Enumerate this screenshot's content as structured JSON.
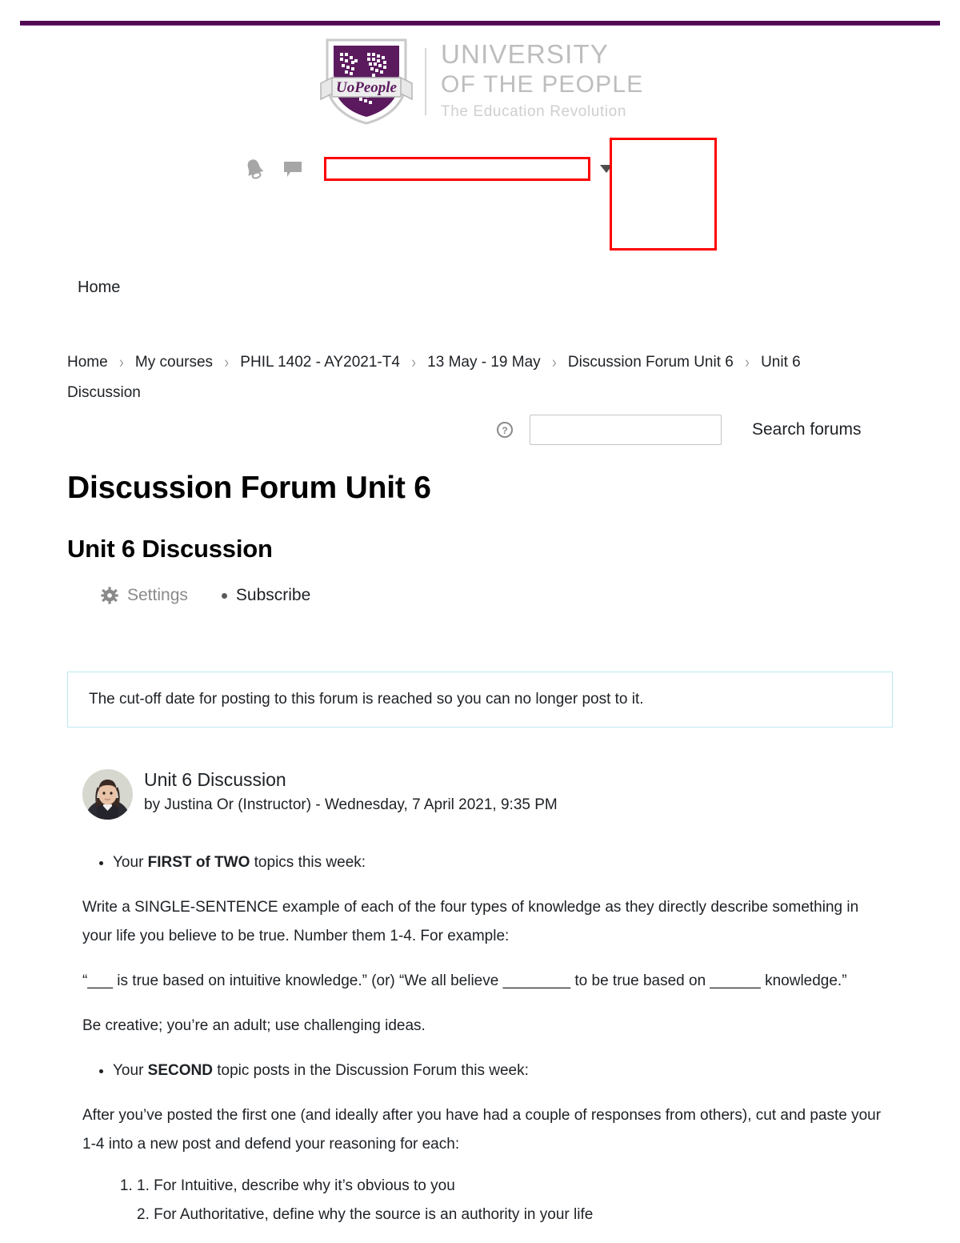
{
  "theme": {
    "brand_purple": "#520a53",
    "highlight_red": "#ff0000",
    "alert_border_blue": "#bce8f1",
    "muted_gray": "#8a8a8a"
  },
  "logo": {
    "badge_text": "UoPeople",
    "line1": "UNIVERSITY",
    "line2": "OF THE PEOPLE",
    "line3": "The Education Revolution"
  },
  "utility_bar": {
    "bell_icon": "bell-icon",
    "messages_icon": "speech-bubble-icon",
    "search_value": "",
    "search_placeholder": "",
    "caret_icon": "chevron-down-icon"
  },
  "primary_nav": {
    "home_label": "Home"
  },
  "breadcrumb": {
    "separator": "›",
    "items": [
      {
        "label": "Home"
      },
      {
        "label": "My courses"
      },
      {
        "label": "PHIL 1402 - AY2021-T4"
      },
      {
        "label": "13 May - 19 May"
      },
      {
        "label": "Discussion Forum Unit 6"
      },
      {
        "label": "Unit 6 Discussion"
      }
    ]
  },
  "forum_search": {
    "help_icon": "help-circle-icon",
    "input_value": "",
    "input_placeholder": "",
    "button_label": "Search forums"
  },
  "headings": {
    "forum_title": "Discussion Forum Unit 6",
    "discussion_title": "Unit 6 Discussion"
  },
  "actions": {
    "settings_icon": "gear-icon",
    "settings_label": "Settings",
    "subscribe_bullet_icon": "dot-icon",
    "subscribe_label": "Subscribe"
  },
  "alert": {
    "message": "The cut-off date for posting to this forum is reached so you can no longer post to it."
  },
  "post": {
    "avatar_icon": "user-avatar-photo",
    "subject": "Unit 6 Discussion",
    "byline": "by Justina Or (Instructor) - Wednesday, 7 April 2021, 9:35 PM",
    "bullet_first": {
      "before": "Your ",
      "bold": "FIRST of TWO",
      "after": " topics this week:"
    },
    "paragraph_1": "Write a SINGLE-SENTENCE example of each of the four types of knowledge as they directly describe something in your life you believe to be true. Number them 1-4.  For example:",
    "paragraph_2": "“___ is true based on intuitive knowledge.” (or) “We all believe ________ to be true based on ______ knowledge.”",
    "paragraph_3": "Be creative; you’re an adult; use challenging ideas.",
    "bullet_second": {
      "before": "Your ",
      "bold": "SECOND",
      "after": " topic posts in the Discussion Forum this week:"
    },
    "paragraph_4": "After you’ve posted the first one (and ideally after you have had a couple of responses from others), cut and paste your 1-4 into a new post and defend your reasoning for each:",
    "numbered_item_lines": [
      "1. For Intuitive, describe why it’s obvious to you",
      "2. For Authoritative, define why the source is an authority in your life"
    ]
  }
}
